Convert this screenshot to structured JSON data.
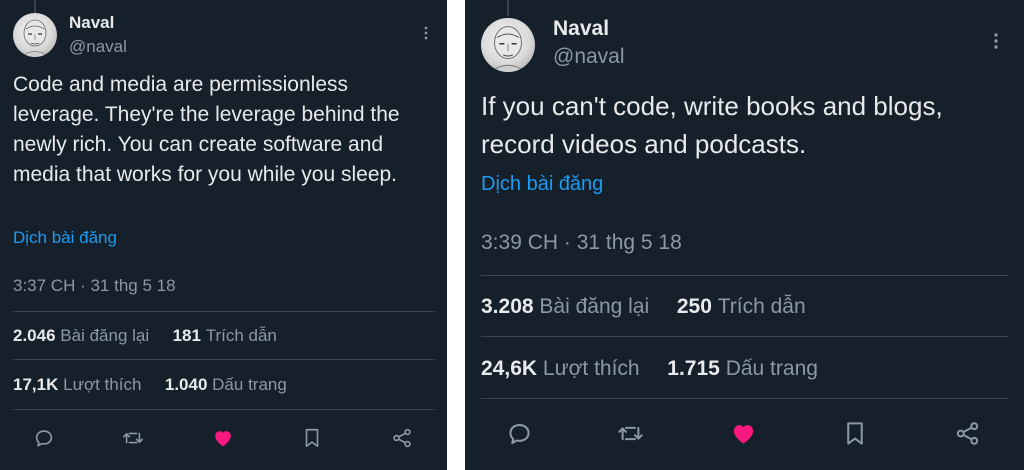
{
  "tweets": [
    {
      "author": {
        "name": "Naval",
        "handle": "@naval"
      },
      "text": "Code and media are permissionless leverage. They're the leverage behind the newly rich. You can create software and media that works for you while you sleep.",
      "translate_label": "Dịch bài đăng",
      "timestamp": "3:37 CH · 31 thg 5 18",
      "stats": {
        "reposts": {
          "value": "2.046",
          "label": "Bài đăng lại"
        },
        "quotes": {
          "value": "181",
          "label": "Trích dẫn"
        },
        "likes": {
          "value": "17,1K",
          "label": "Lượt thích"
        },
        "bookmarks": {
          "value": "1.040",
          "label": "Dấu trang"
        }
      },
      "liked": true
    },
    {
      "author": {
        "name": "Naval",
        "handle": "@naval"
      },
      "text": "If you can't code, write books and blogs, record videos and podcasts.",
      "translate_label": "Dịch bài đăng",
      "timestamp": "3:39 CH · 31 thg 5 18",
      "stats": {
        "reposts": {
          "value": "3.208",
          "label": "Bài đăng lại"
        },
        "quotes": {
          "value": "250",
          "label": "Trích dẫn"
        },
        "likes": {
          "value": "24,6K",
          "label": "Lượt thích"
        },
        "bookmarks": {
          "value": "1.715",
          "label": "Dấu trang"
        }
      },
      "liked": true
    }
  ],
  "colors": {
    "background": "#15202b",
    "text": "#e7e9ea",
    "secondary": "#8b98a5",
    "link": "#1d9bf0",
    "like": "#f91880",
    "divider": "#38444d"
  },
  "icons": [
    "more-icon",
    "reply-icon",
    "repost-icon",
    "like-icon",
    "bookmark-icon",
    "share-icon"
  ]
}
